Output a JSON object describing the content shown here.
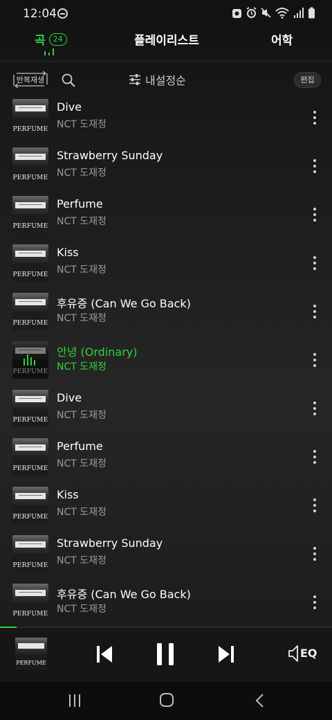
{
  "status_bar": {
    "time": "12:04",
    "icons": [
      "do-not-disturb-icon",
      "data-saver-icon",
      "alarm-icon",
      "mute-icon",
      "wifi-icon",
      "signal-icon",
      "battery-icon"
    ]
  },
  "tabs": {
    "songs_label": "곡",
    "songs_count": "24",
    "playlist_label": "플레이리스트",
    "lang_label": "어학"
  },
  "toolbar": {
    "repeat_label": "반복재생",
    "sort_label": "내설정순",
    "edit_label": "편집"
  },
  "album_word": "PERFUME",
  "songs": [
    {
      "title": "Dive",
      "artist": "NCT 도재정",
      "playing": false
    },
    {
      "title": "Strawberry Sunday",
      "artist": "NCT 도재정",
      "playing": false
    },
    {
      "title": "Perfume",
      "artist": "NCT 도재정",
      "playing": false
    },
    {
      "title": "Kiss",
      "artist": "NCT 도재정",
      "playing": false
    },
    {
      "title": "후유증 (Can We Go Back)",
      "artist": "NCT 도재정",
      "playing": false
    },
    {
      "title": "안녕 (Ordinary)",
      "artist": "NCT 도재정",
      "playing": true
    },
    {
      "title": "Dive",
      "artist": "NCT 도재정",
      "playing": false
    },
    {
      "title": "Perfume",
      "artist": "NCT 도재정",
      "playing": false
    },
    {
      "title": "Kiss",
      "artist": "NCT 도재정",
      "playing": false
    },
    {
      "title": "Strawberry Sunday",
      "artist": "NCT 도재정",
      "playing": false
    },
    {
      "title": "후유증 (Can We Go Back)",
      "artist": "NCT 도재정",
      "playing": false
    }
  ],
  "player": {
    "progress": 0.05,
    "eq_label": "EQ"
  },
  "colors": {
    "accent": "#2fd43a",
    "background": "#151515",
    "secondary_text": "#9a9a9a"
  }
}
